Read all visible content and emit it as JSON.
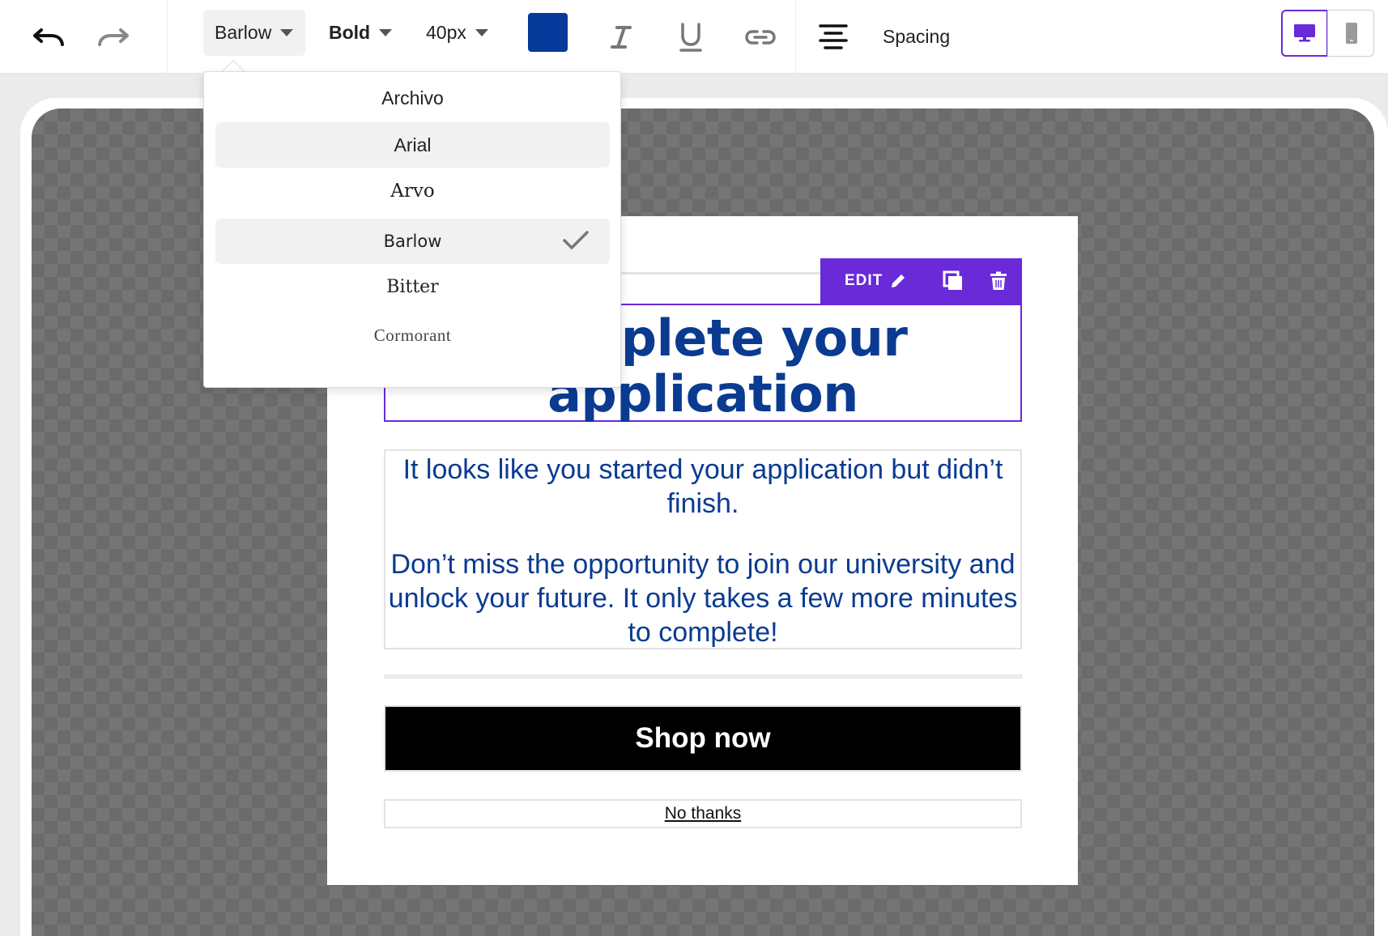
{
  "toolbar": {
    "undo_icon": "undo-icon",
    "redo_icon": "redo-icon",
    "font_family": "Barlow",
    "font_weight": "Bold",
    "font_size": "40px",
    "text_color": "#05399a",
    "italic_icon": "italic-icon",
    "underline_icon": "underline-icon",
    "link_icon": "link-icon",
    "align_icon": "align-center-icon",
    "spacing_label": "Spacing",
    "views": [
      {
        "name": "desktop",
        "icon": "desktop-icon",
        "active": true
      },
      {
        "name": "mobile",
        "icon": "mobile-icon",
        "active": false
      }
    ]
  },
  "font_dropdown": {
    "items": [
      {
        "label": "Archivo",
        "font": "sans",
        "highlighted": false,
        "selected": false
      },
      {
        "label": "Arial",
        "font": "sans",
        "highlighted": true,
        "selected": false
      },
      {
        "label": "Arvo",
        "font": "serif",
        "highlighted": false,
        "selected": false
      },
      {
        "label": "Barlow",
        "font": "sans",
        "highlighted": true,
        "selected": true
      },
      {
        "label": "Bitter",
        "font": "serif",
        "highlighted": false,
        "selected": false
      },
      {
        "label": "Cormorant",
        "font": "serif-light",
        "highlighted": false,
        "selected": false
      }
    ]
  },
  "popup": {
    "heading": "Complete your application",
    "edit_toolbar": {
      "edit_label": "EDIT",
      "icons": [
        "pencil-icon",
        "duplicate-icon",
        "trash-icon"
      ]
    },
    "body": {
      "paragraph1": "It looks like you started your application but didn’t finish.",
      "paragraph2": "Don’t miss the opportunity to join our university and unlock your future. It only takes a few more minutes to complete!"
    },
    "cta_label": "Shop now",
    "dismiss_label": "No thanks"
  },
  "colors": {
    "accent": "#6a2ad8",
    "heading_text": "#0a3b91",
    "button_bg": "#000000"
  }
}
